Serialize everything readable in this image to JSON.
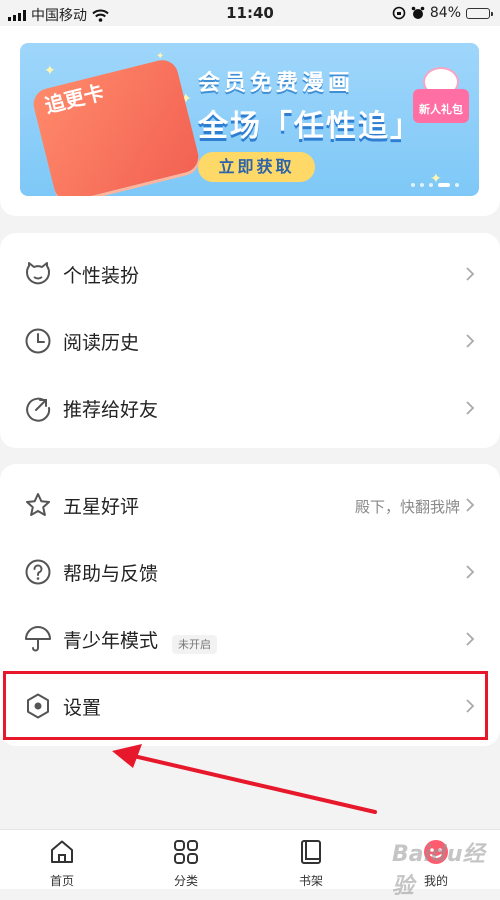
{
  "status_bar": {
    "carrier": "中国移动",
    "time": "11:40",
    "battery": "84%",
    "battery_level": 0.84
  },
  "banner": {
    "ticket_label": "追更卡",
    "line1": "会员免费漫画",
    "line2": "全场「任性追」",
    "cta": "立即获取",
    "gift_label": "新人礼包"
  },
  "menu_group1": [
    {
      "label": "个性装扮",
      "icon": "cat-face-icon"
    },
    {
      "label": "阅读历史",
      "icon": "clock-icon"
    },
    {
      "label": "推荐给好友",
      "icon": "share-icon"
    }
  ],
  "menu_group2": [
    {
      "label": "五星好评",
      "icon": "star-outline-icon",
      "extra": "殿下，快翻我牌"
    },
    {
      "label": "帮助与反馈",
      "icon": "help-icon"
    },
    {
      "label": "青少年模式",
      "icon": "umbrella-icon",
      "badge": "未开启"
    },
    {
      "label": "设置",
      "icon": "settings-hexagon-icon"
    }
  ],
  "bottom_nav": [
    {
      "label": "首页",
      "icon": "home-icon"
    },
    {
      "label": "分类",
      "icon": "grid-icon"
    },
    {
      "label": "书架",
      "icon": "bookshelf-icon"
    },
    {
      "label": "我的",
      "icon": "profile-icon"
    }
  ],
  "watermark": "Baidu经验",
  "colors": {
    "background": "#f3f3f3",
    "highlight": "#e8182c",
    "banner_cta": "#ffd967"
  }
}
